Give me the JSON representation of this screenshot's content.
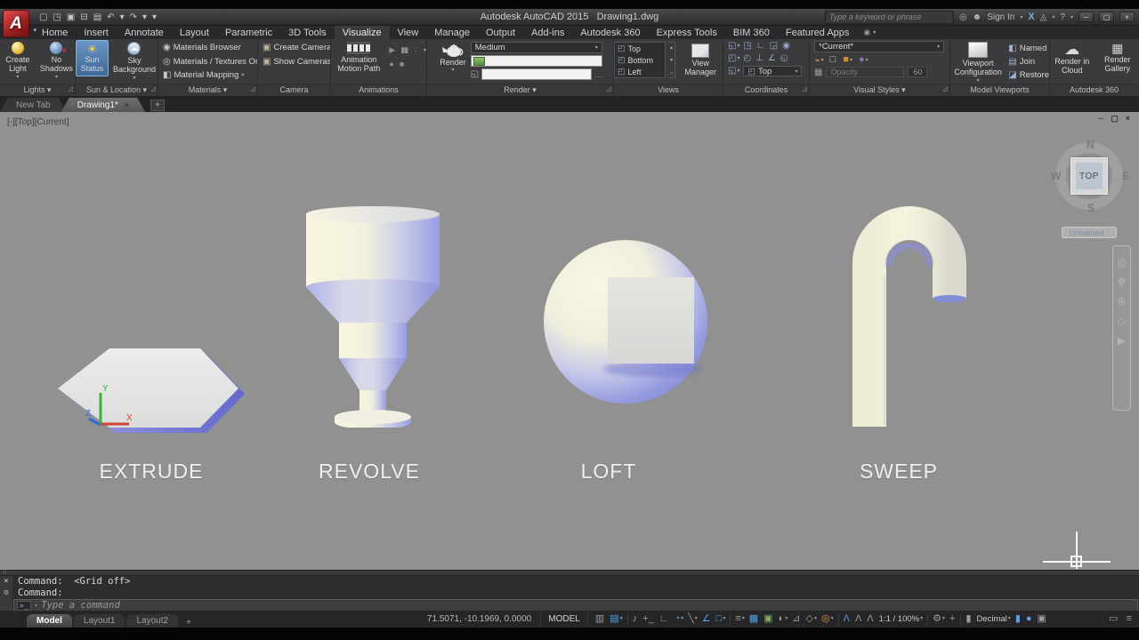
{
  "colors": {
    "accent_blue": "#55a0e8",
    "highlight_button": "#4a7db2",
    "viewport_bg": "#919191",
    "shape_cream": "#f5f2de",
    "shape_lavender": "#9aa0e0",
    "logo_red": "#a02020"
  },
  "titlebar": {
    "logo": "A",
    "qat_icons": [
      {
        "g": "▢"
      },
      {
        "g": "◳"
      },
      {
        "g": "▣"
      },
      {
        "g": "⊟"
      },
      {
        "g": "▤"
      },
      {
        "g": "↶"
      },
      {
        "g": "▾"
      },
      {
        "g": "↷"
      },
      {
        "g": "▾"
      },
      {
        "g": "▾"
      }
    ],
    "app_title": "Autodesk AutoCAD 2015   Drawing1.dwg",
    "search_placeholder": "Type a keyword or phrase",
    "sign_in": "Sign In",
    "exchange": "X",
    "help": "?"
  },
  "ribbon": {
    "tabs": [
      {
        "label": "Home"
      },
      {
        "label": "Insert"
      },
      {
        "label": "Annotate"
      },
      {
        "label": "Layout"
      },
      {
        "label": "Parametric"
      },
      {
        "label": "3D Tools"
      },
      {
        "label": "Visualize",
        "cls": "active"
      },
      {
        "label": "View"
      },
      {
        "label": "Manage"
      },
      {
        "label": "Output"
      },
      {
        "label": "Add-ins"
      },
      {
        "label": "Autodesk 360"
      },
      {
        "label": "Express Tools"
      },
      {
        "label": "BIM 360"
      },
      {
        "label": "Featured Apps"
      }
    ],
    "panels": {
      "lights": {
        "label": "Lights ▾",
        "create_light": "Create Light",
        "no_shadows": "No Shadows"
      },
      "sun": {
        "label": "Sun & Location ▾",
        "sun_status": "Sun Status",
        "sky_background": "Sky Background"
      },
      "materials": {
        "label": "Materials ▾",
        "items": [
          {
            "icon": "◉",
            "label": "Materials Browser"
          },
          {
            "icon": "◎",
            "label": "Materials / Textures On",
            "dd": "▾"
          },
          {
            "icon": "◧",
            "label": "Material Mapping",
            "dd": "▾"
          }
        ]
      },
      "camera": {
        "label": "Camera",
        "items": [
          {
            "icon": "▣",
            "label": "Create Camera"
          },
          {
            "icon": "▣",
            "label": "Show Cameras"
          }
        ]
      },
      "animations": {
        "label": "Animations",
        "motion_path": "Animation Motion Path"
      },
      "render": {
        "label": "Render ▾",
        "render_btn": "Render",
        "quality": "Medium",
        "browse": "…"
      },
      "views": {
        "label": "Views",
        "list": [
          "Top",
          "Bottom",
          "Left"
        ],
        "view_manager": "View Manager"
      },
      "coordinates": {
        "label": "Coordinates",
        "row1": [
          {
            "g": "◱",
            "dd": "▾"
          },
          {
            "g": "◳"
          },
          {
            "g": "∟"
          },
          {
            "g": "◲"
          },
          {
            "g": "◉"
          }
        ],
        "row2": [
          {
            "g": "◰",
            "dd": "▾"
          },
          {
            "g": "◴"
          },
          {
            "g": "⊥"
          },
          {
            "g": "∠"
          },
          {
            "g": "◵"
          }
        ],
        "ucs_icon": "◱",
        "ucs_dropdown": "Top"
      },
      "visual_styles": {
        "label": "Visual Styles ▾",
        "current": "*Current*",
        "icons": [
          {
            "g": "◒",
            "c": "vs-red",
            "dd": "▾"
          },
          {
            "g": "□",
            "c": "vs-gray"
          },
          {
            "g": "■",
            "c": "vs-orange",
            "dd": "▾"
          },
          {
            "g": "●",
            "c": "vs-purple",
            "dd": "▾"
          }
        ],
        "opacity_label": "Opacity",
        "opacity_value": "60"
      },
      "viewports": {
        "label": "Model Viewports",
        "config": "Viewport Configuration",
        "named": "Named",
        "join": "Join",
        "restore": "Restore"
      },
      "a360": {
        "label": "Autodesk 360",
        "render_cloud": "Render in Cloud",
        "render_gallery": "Render Gallery"
      }
    }
  },
  "file_tabs": {
    "new_tab": "New Tab",
    "drawing": "Drawing1*"
  },
  "viewport": {
    "label": "[-][Top][Current]",
    "viewcube": {
      "n": "N",
      "s": "S",
      "e": "E",
      "w": "W",
      "face": "TOP",
      "named_view": "Unnamed"
    },
    "ucs": {
      "x": "X",
      "y": "Y",
      "z": "Z"
    },
    "shapes": [
      {
        "name": "EXTRUDE"
      },
      {
        "name": "REVOLVE"
      },
      {
        "name": "LOFT"
      },
      {
        "name": "SWEEP"
      }
    ]
  },
  "command_line": {
    "history": [
      "Command:  <Grid off>",
      "Command:"
    ],
    "placeholder": "Type a command"
  },
  "statusbar": {
    "layout_tabs": [
      {
        "label": "Model",
        "cls": "active"
      },
      {
        "label": "Layout1"
      },
      {
        "label": "Layout2"
      }
    ],
    "coordinates": "71.5071, -10.1969, 0.0000",
    "model_btn": "MODEL",
    "icons": [
      {
        "g": "▥",
        "c": "gray"
      },
      {
        "g": "▤",
        "c": "blue",
        "dd": "▾"
      },
      {
        "g": "",
        "c": "sep"
      },
      {
        "g": "♪",
        "c": "gray"
      },
      {
        "g": "+_",
        "c": "gray"
      },
      {
        "g": "∟",
        "c": "gray"
      },
      {
        "g": "◔",
        "c": "blue",
        "dd": "▾"
      },
      {
        "g": "╲",
        "c": "gray",
        "dd": "▾"
      },
      {
        "g": "∠",
        "c": "blue"
      },
      {
        "g": "□",
        "c": "blue",
        "dd": "▾"
      },
      {
        "g": "",
        "c": "sep"
      },
      {
        "g": "≡",
        "c": "gray",
        "dd": "▾"
      },
      {
        "g": "▦",
        "c": "blue"
      },
      {
        "g": "▣",
        "c": "green"
      },
      {
        "g": "◐",
        "c": "gray",
        "dd": "▾"
      },
      {
        "g": "⊿",
        "c": "gray"
      },
      {
        "g": "◇",
        "c": "gray",
        "dd": "▾"
      },
      {
        "g": "◎",
        "c": "orange",
        "dd": "▾"
      },
      {
        "g": "",
        "c": "sep"
      },
      {
        "g": "Λ",
        "c": "blue"
      },
      {
        "g": "Λ",
        "c": "gray"
      },
      {
        "g": "Λ",
        "c": "gray"
      },
      {
        "g": "1:1 / 100%",
        "c": "txt",
        "dd": "▾"
      },
      {
        "g": "",
        "c": "sep"
      },
      {
        "g": "⚙",
        "c": "gray",
        "dd": "▾"
      },
      {
        "g": "+",
        "c": "gray"
      },
      {
        "g": "",
        "c": "sep"
      },
      {
        "g": "▮",
        "c": "gray"
      },
      {
        "g": "Decimal",
        "c": "txt",
        "dd": "▾"
      },
      {
        "g": "▮",
        "c": "blue"
      },
      {
        "g": "●",
        "c": "blue"
      },
      {
        "g": "▣",
        "c": "gray"
      }
    ],
    "right_icons": [
      {
        "g": "▭",
        "c": "gray"
      },
      {
        "g": "≡",
        "c": "gray"
      }
    ]
  }
}
